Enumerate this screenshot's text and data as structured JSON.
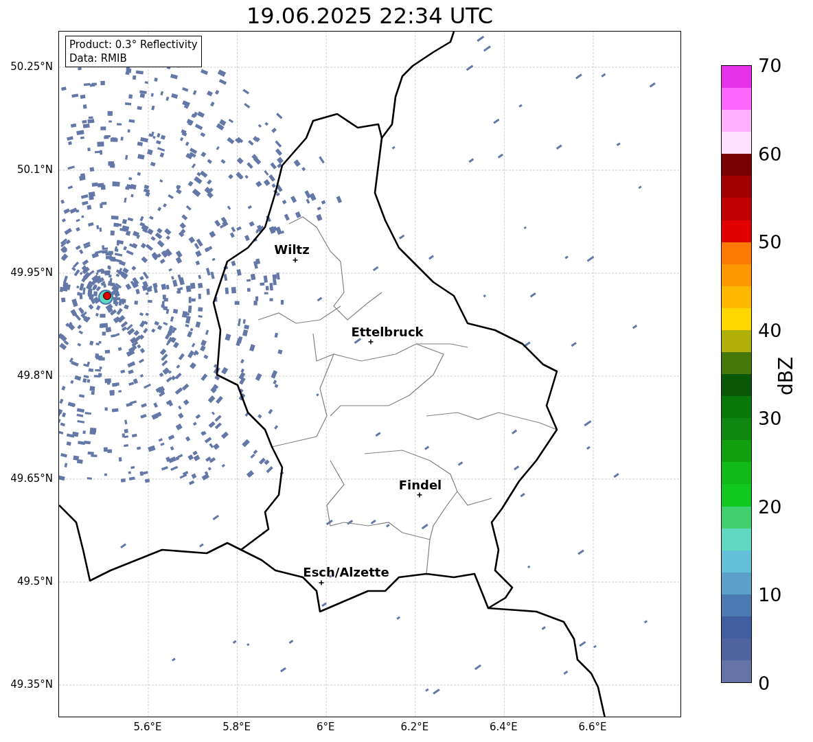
{
  "title": "19.06.2025 22:34 UTC",
  "info_box": {
    "lines": [
      "Product: 0.3° Reflectivity",
      "Data: RMIB"
    ]
  },
  "y_ticks": [
    "50.25°N",
    "50.1°N",
    "49.95°N",
    "49.8°N",
    "49.65°N",
    "49.5°N",
    "49.35°N"
  ],
  "x_ticks": [
    "5.6°E",
    "5.8°E",
    "6°E",
    "6.2°E",
    "6.4°E",
    "6.6°E"
  ],
  "cities": [
    {
      "name": "Wiltz"
    },
    {
      "name": "Ettelbruck"
    },
    {
      "name": "Findel"
    },
    {
      "name": "Esch/Alzette"
    }
  ],
  "colorbar": {
    "label": "dBZ",
    "ticks": [
      "70",
      "60",
      "50",
      "40",
      "30",
      "20",
      "10",
      "0"
    ],
    "segments": [
      {
        "color": "#e830e8"
      },
      {
        "color": "#ff68ff"
      },
      {
        "color": "#ffb0ff"
      },
      {
        "color": "#ffe0ff"
      },
      {
        "color": "#780000"
      },
      {
        "color": "#a00000"
      },
      {
        "color": "#c00000"
      },
      {
        "color": "#e00000"
      },
      {
        "color": "#ff7800"
      },
      {
        "color": "#ff9800"
      },
      {
        "color": "#ffb800"
      },
      {
        "color": "#ffd800"
      },
      {
        "color": "#b0b008"
      },
      {
        "color": "#447808"
      },
      {
        "color": "#085808"
      },
      {
        "color": "#087808"
      },
      {
        "color": "#108810"
      },
      {
        "color": "#10a010"
      },
      {
        "color": "#10b818"
      },
      {
        "color": "#10c820"
      },
      {
        "color": "#40d070"
      },
      {
        "color": "#60d8c0"
      },
      {
        "color": "#64c0d8"
      },
      {
        "color": "#5aa0c8"
      },
      {
        "color": "#4a7ab0"
      },
      {
        "color": "#405ea0"
      },
      {
        "color": "#5064a0"
      },
      {
        "color": "#6474a4"
      }
    ]
  }
}
